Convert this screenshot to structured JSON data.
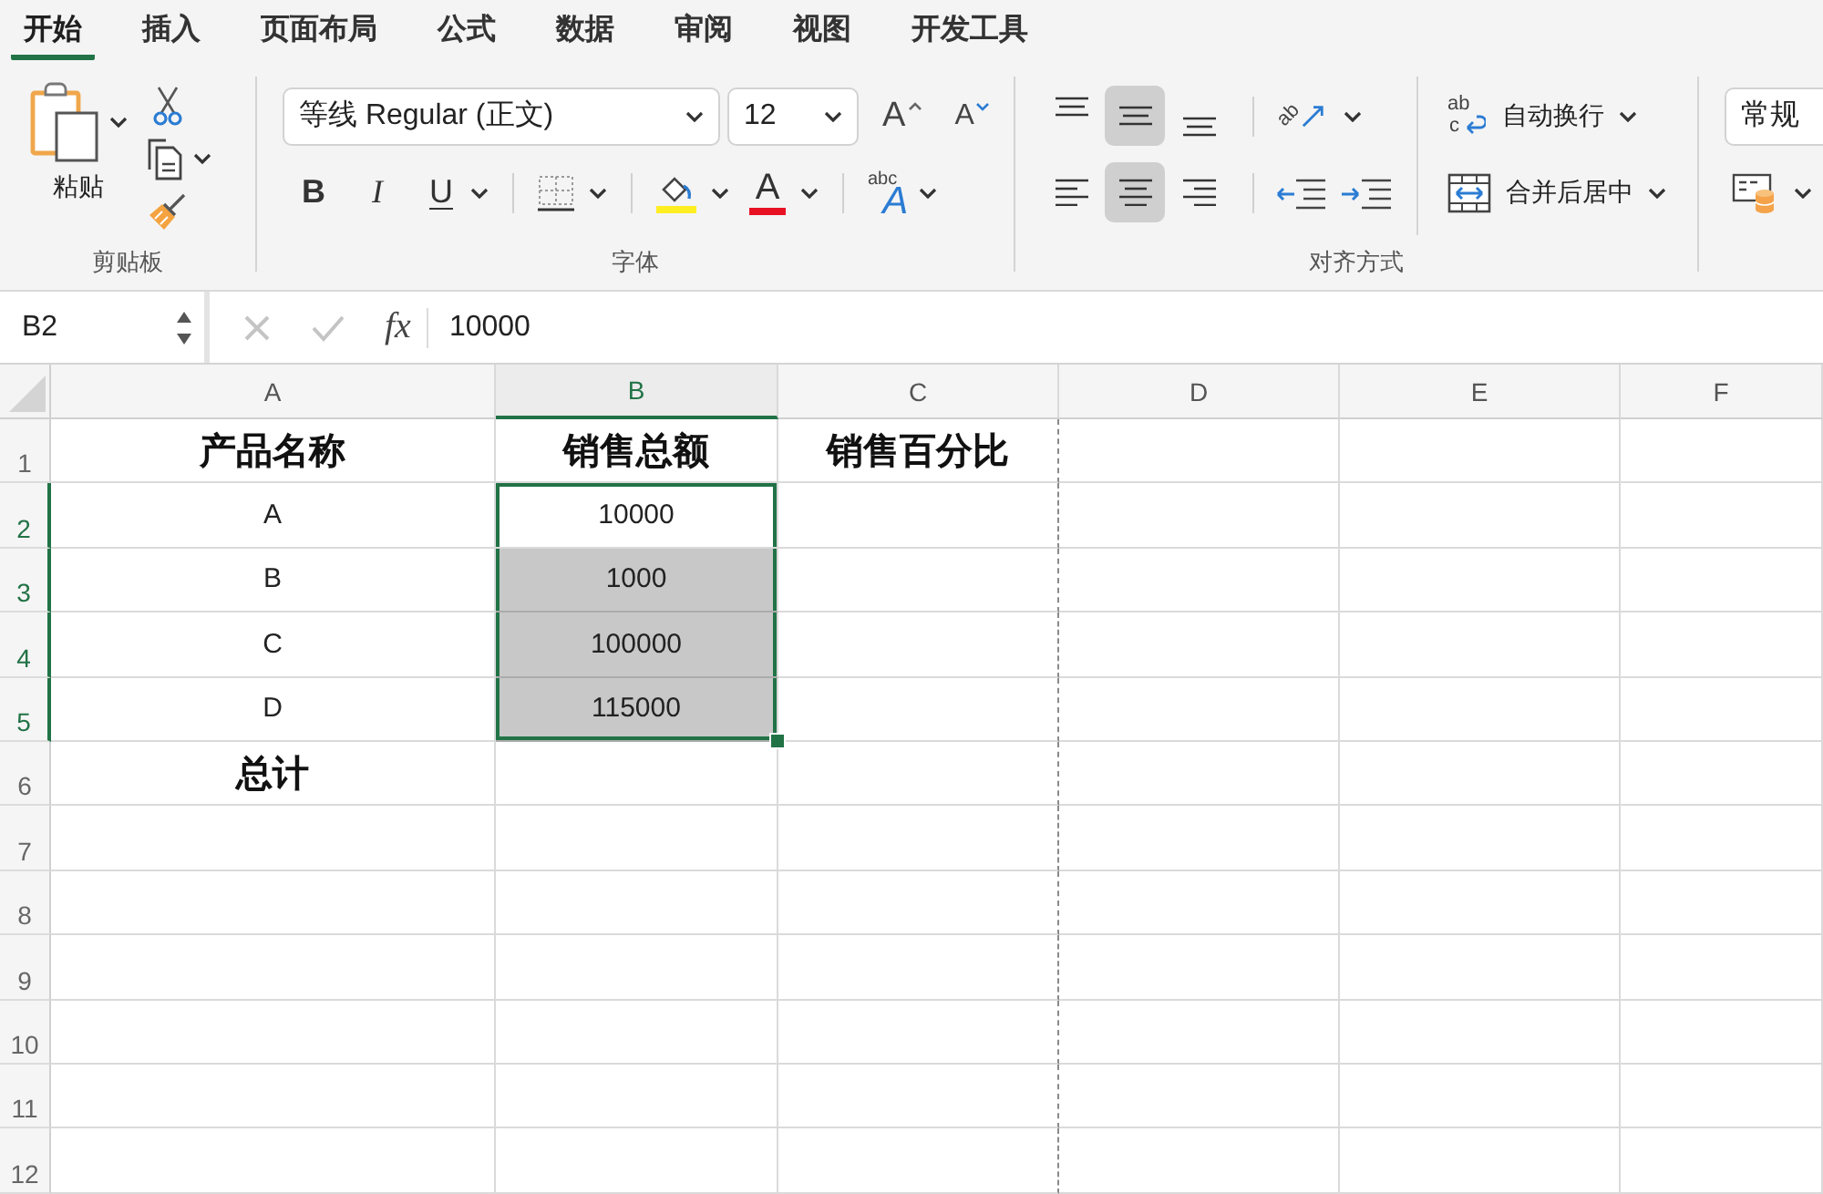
{
  "tabs": [
    {
      "label": "开始",
      "selected": true
    },
    {
      "label": "插入",
      "selected": false
    },
    {
      "label": "页面布局",
      "selected": false
    },
    {
      "label": "公式",
      "selected": false
    },
    {
      "label": "数据",
      "selected": false
    },
    {
      "label": "审阅",
      "selected": false
    },
    {
      "label": "视图",
      "selected": false
    },
    {
      "label": "开发工具",
      "selected": false
    }
  ],
  "ribbon": {
    "clipboard": {
      "paste": "粘贴",
      "label": "剪贴板"
    },
    "font": {
      "font_name": "等线 Regular (正文)",
      "font_size": "12",
      "grow": "A",
      "shrink": "A",
      "styles": [
        {
          "kind": "bold",
          "label": "B",
          "on": false
        },
        {
          "kind": "italic",
          "label": "I",
          "on": false
        },
        {
          "kind": "underline",
          "label": "U",
          "on": false
        }
      ],
      "font_color": "A",
      "phonetic": {
        "small": "abc",
        "large": "A"
      },
      "label": "字体"
    },
    "alignment": {
      "vertical": [
        {
          "kind": "top",
          "selected": false
        },
        {
          "kind": "middle",
          "selected": true
        },
        {
          "kind": "bottom",
          "selected": false
        }
      ],
      "orientation": "ab",
      "horizontal": [
        {
          "kind": "left",
          "selected": false
        },
        {
          "kind": "center",
          "selected": true
        },
        {
          "kind": "right",
          "selected": false
        }
      ],
      "wrap_icon": {
        "top": "ab",
        "bottom": "c"
      },
      "wrap_text": "自动换行",
      "merge_center": "合并后居中",
      "label": "对齐方式"
    },
    "number": {
      "format": "常规"
    }
  },
  "formula_bar": {
    "name_box": "B2",
    "function_button": "fx",
    "formula": "10000"
  },
  "sheet": {
    "columns": [
      {
        "label": "A",
        "selected": false,
        "page_break": false
      },
      {
        "label": "B",
        "selected": true,
        "page_break": false
      },
      {
        "label": "C",
        "selected": false,
        "page_break": true
      },
      {
        "label": "D",
        "selected": false,
        "page_break": false
      },
      {
        "label": "E",
        "selected": false,
        "page_break": false
      },
      {
        "label": "F",
        "selected": false,
        "page_break": false
      }
    ],
    "rows": [
      {
        "label": "1",
        "selected": false,
        "cells": [
          {
            "text": "产品名称",
            "bold": true,
            "selected": false
          },
          {
            "text": "销售总额",
            "bold": true,
            "selected": false
          },
          {
            "text": "销售百分比",
            "bold": true,
            "selected": false
          }
        ]
      },
      {
        "label": "2",
        "selected": true,
        "cells": [
          {
            "text": "A",
            "bold": false,
            "selected": false
          },
          {
            "text": "10000",
            "bold": false,
            "selected": true,
            "active": true
          }
        ]
      },
      {
        "label": "3",
        "selected": true,
        "cells": [
          {
            "text": "B",
            "bold": false,
            "selected": false
          },
          {
            "text": "1000",
            "bold": false,
            "selected": true
          }
        ]
      },
      {
        "label": "4",
        "selected": true,
        "cells": [
          {
            "text": "C",
            "bold": false,
            "selected": false
          },
          {
            "text": "100000",
            "bold": false,
            "selected": true
          }
        ]
      },
      {
        "label": "5",
        "selected": true,
        "cells": [
          {
            "text": "D",
            "bold": false,
            "selected": false
          },
          {
            "text": "115000",
            "bold": false,
            "selected": true
          }
        ]
      },
      {
        "label": "6",
        "selected": false,
        "cells": [
          {
            "text": "总计",
            "bold": true,
            "selected": false
          }
        ]
      },
      {
        "label": "7",
        "selected": false
      },
      {
        "label": "8",
        "selected": false
      },
      {
        "label": "9",
        "selected": false
      },
      {
        "label": "10",
        "selected": false
      },
      {
        "label": "11",
        "selected": false
      },
      {
        "label": "12",
        "selected": false
      }
    ]
  }
}
